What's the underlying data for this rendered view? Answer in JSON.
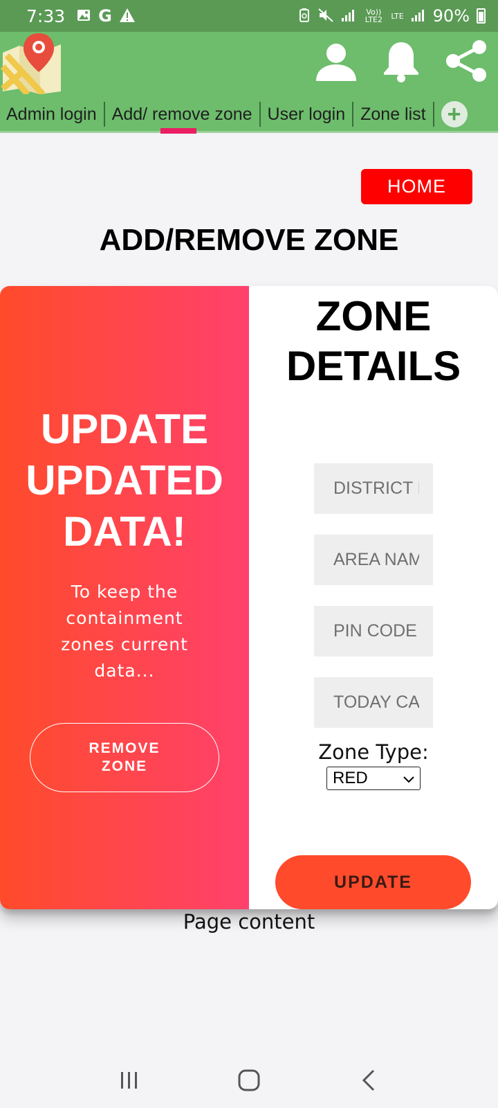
{
  "status_bar": {
    "time": "7:33",
    "battery": "90%",
    "lte_top": "Vo)) LTE2",
    "lte_right": "LTE"
  },
  "header": {
    "tabs": [
      {
        "label": "Admin login"
      },
      {
        "label": "Add/ remove zone",
        "active": true
      },
      {
        "label": "User login"
      },
      {
        "label": "Zone list"
      }
    ],
    "icons": [
      "user-icon",
      "bell-icon",
      "share-icon"
    ],
    "colors": {
      "header_bg": "#6dbd6c",
      "status_bg": "#5a9a55",
      "tab_indicator": "#e91e63"
    }
  },
  "home_button": "HOME",
  "page_title": "ADD/REMOVE ZONE",
  "overlay": {
    "title": "UPDATE UPDATED DATA!",
    "text": "To keep the containment zones current data...",
    "remove_button": "REMOVE ZONE"
  },
  "form": {
    "title": "ZONE DETAILS",
    "fields": [
      {
        "placeholder": "DISTRICT NAME"
      },
      {
        "placeholder": "AREA NAME"
      },
      {
        "placeholder": "PIN CODE"
      },
      {
        "placeholder": "TODAY CASES"
      }
    ],
    "zone_type_label": "Zone Type:",
    "zone_type_value": "RED",
    "update_button": "UPDATE"
  },
  "footer_text": "Page content"
}
